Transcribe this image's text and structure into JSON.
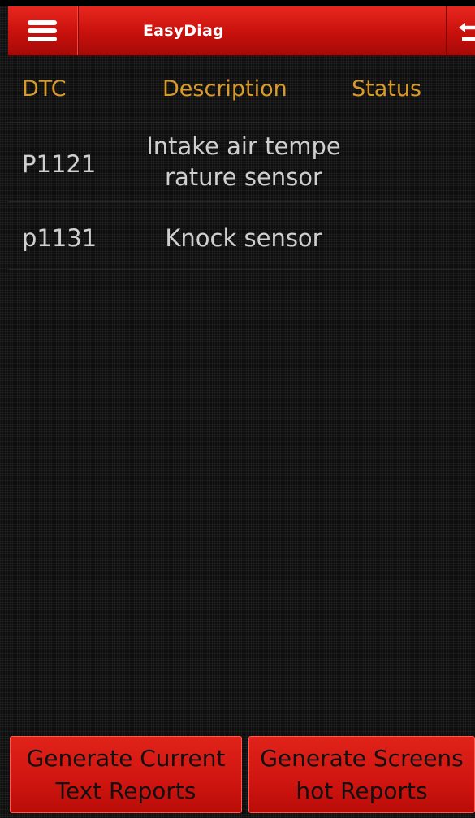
{
  "app": {
    "title": "EasyDiag"
  },
  "toolbar": {
    "menu_icon": "hamburger-menu-icon",
    "back_icon": "back-arrow-icon"
  },
  "table": {
    "headers": [
      "DTC",
      "Description",
      "Status"
    ],
    "rows": [
      {
        "code": "P1121",
        "description_lines": [
          "Intake air tempe",
          "rature sensor"
        ],
        "status": ""
      },
      {
        "code": "p1131",
        "description_lines": [
          "Knock sensor"
        ],
        "status": ""
      }
    ]
  },
  "buttons": {
    "text_report_lines": [
      "Generate Current",
      "Text Reports"
    ],
    "screenshot_report_lines": [
      "Generate Screens",
      "hot Reports"
    ]
  },
  "colors": {
    "titlebar_red": "#c8100c",
    "header_text": "#d89b2a",
    "cell_text": "#cfcfcf",
    "button_red": "#cf1510"
  }
}
